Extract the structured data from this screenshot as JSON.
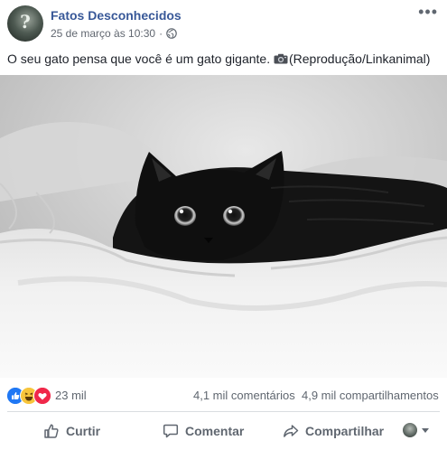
{
  "post": {
    "page_name": "Fatos Desconhecidos",
    "avatar_mark": "?",
    "timestamp": "25 de março às 10:30",
    "separator": "·",
    "audience_icon": "globe-icon",
    "more_icon": "•••",
    "caption_before": "O seu gato pensa que você é um gato gigante.",
    "caption_after": "(Reprodução/Linkanimal)",
    "photo_description": "black-cat-on-white-bed"
  },
  "stats": {
    "reaction_icons": [
      "like-icon",
      "haha-icon",
      "love-icon"
    ],
    "reactions_count": "23 mil",
    "comments_count": "4,1 mil comentários",
    "shares_count": "4,9 mil compartilhamentos"
  },
  "actions": {
    "like_label": "Curtir",
    "comment_label": "Comentar",
    "share_label": "Compartilhar"
  },
  "colors": {
    "link": "#385898",
    "muted": "#606770",
    "like": "#2078f4",
    "haha": "#f7c53c",
    "love": "#f0284a",
    "divider": "#dadde1"
  }
}
